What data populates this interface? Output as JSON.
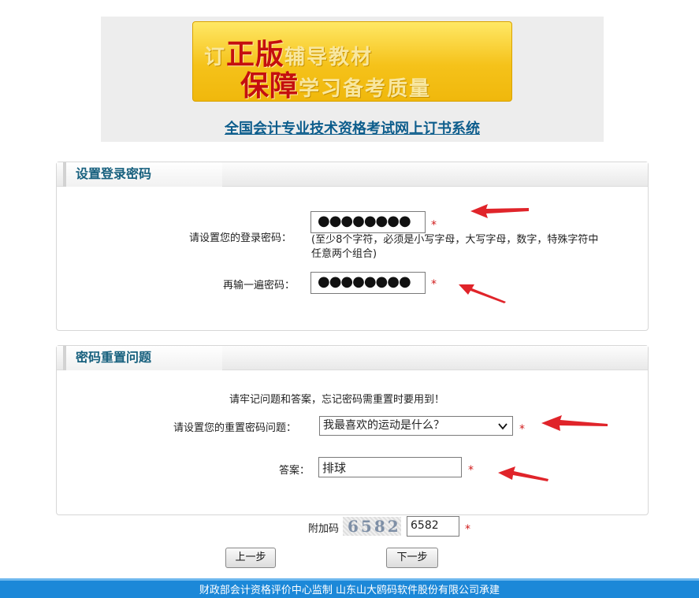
{
  "header": {
    "banner": {
      "line1_small_a": "订",
      "line1_big": "正版",
      "line1_small_b": "辅导教材",
      "line2_big": "保障",
      "line2_small": "学习备考质量"
    },
    "site_title": "全国会计专业技术资格考试网上订书系统"
  },
  "password_section": {
    "title": "设置登录密码",
    "password_label": "请设置您的登录密码：",
    "password_value": "●●●●●●●●",
    "password_hint": "(至少8个字符，必须是小写字母，大写字母，数字，特殊字符中任意两个组合)",
    "confirm_label": "再输一遍密码：",
    "confirm_value": "●●●●●●●●",
    "required_mark": "*"
  },
  "reset_section": {
    "title": "密码重置问题",
    "notice": "请牢记问题和答案，忘记密码需重置时要用到！",
    "question_label": "请设置您的重置密码问题：",
    "question_value": "我最喜欢的运动是什么？",
    "answer_label": "答案：",
    "answer_value": "排球",
    "required_mark": "*"
  },
  "captcha": {
    "label": "附加码",
    "image_text": "6582",
    "input_value": "6582",
    "required_mark": "*"
  },
  "buttons": {
    "prev": "上一步",
    "next": "下一步"
  },
  "footer": {
    "text": "财政部会计资格评价中心监制        山东山大鸥码软件股份有限公司承建"
  },
  "colors": {
    "accent_red": "#d01a1a",
    "title_blue": "#17607e",
    "footer_blue": "#1c88d8"
  }
}
